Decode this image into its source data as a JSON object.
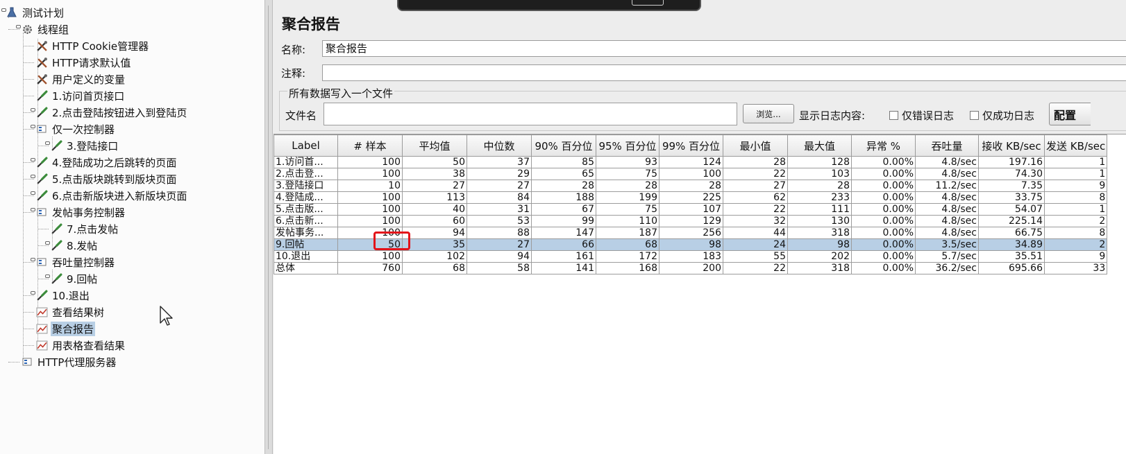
{
  "tree": {
    "items": [
      {
        "label": "测试计划",
        "icon": "test-plan-icon"
      },
      {
        "label": "线程组",
        "icon": "gear-icon"
      },
      {
        "label": "HTTP Cookie管理器",
        "icon": "config-element-icon"
      },
      {
        "label": "HTTP请求默认值",
        "icon": "config-element-icon"
      },
      {
        "label": "用户定义的变量",
        "icon": "config-element-icon"
      },
      {
        "label": "1.访问首页接口",
        "icon": "sampler-icon"
      },
      {
        "label": "2.点击登陆按钮进入到登陆页",
        "icon": "sampler-icon"
      },
      {
        "label": "仅一次控制器",
        "icon": "controller-icon"
      },
      {
        "label": "3.登陆接口",
        "icon": "sampler-icon"
      },
      {
        "label": "4.登陆成功之后跳转的页面",
        "icon": "sampler-icon"
      },
      {
        "label": "5.点击版块跳转到版块页面",
        "icon": "sampler-icon"
      },
      {
        "label": "6.点击新版块进入新版块页面",
        "icon": "sampler-icon"
      },
      {
        "label": "发帖事务控制器",
        "icon": "controller-icon"
      },
      {
        "label": "7.点击发帖",
        "icon": "sampler-icon"
      },
      {
        "label": "8.发帖",
        "icon": "sampler-icon"
      },
      {
        "label": "吞吐量控制器",
        "icon": "controller-icon"
      },
      {
        "label": "9.回帖",
        "icon": "sampler-icon"
      },
      {
        "label": "10.退出",
        "icon": "sampler-icon"
      },
      {
        "label": "查看结果树",
        "icon": "listener-icon"
      },
      {
        "label": "聚合报告",
        "icon": "listener-icon"
      },
      {
        "label": "用表格查看结果",
        "icon": "listener-icon"
      },
      {
        "label": "HTTP代理服务器",
        "icon": "proxy-icon"
      }
    ],
    "selected_index": 19
  },
  "panel": {
    "title": "聚合报告",
    "name_label": "名称:",
    "name_value": "聚合报告",
    "comment_label": "注释:",
    "comment_value": "",
    "file_group_title": "所有数据写入一个文件",
    "filename_label": "文件名",
    "filename_value": "",
    "browse_label": "浏览...",
    "log_content_label": "显示日志内容:",
    "errors_only_label": "仅错误日志",
    "success_only_label": "仅成功日志",
    "config_label": "配置"
  },
  "table": {
    "headers": [
      "Label",
      "# 样本",
      "平均值",
      "中位数",
      "90% 百分位",
      "95% 百分位",
      "99% 百分位",
      "最小值",
      "最大值",
      "异常 %",
      "吞吐量",
      "接收 KB/sec",
      "发送 KB/sec"
    ],
    "rows": [
      [
        "1.访问首...",
        "100",
        "50",
        "37",
        "85",
        "93",
        "124",
        "28",
        "128",
        "0.00%",
        "4.8/sec",
        "197.16",
        "1"
      ],
      [
        "2.点击登...",
        "100",
        "38",
        "29",
        "65",
        "75",
        "100",
        "22",
        "103",
        "0.00%",
        "4.8/sec",
        "74.30",
        "1"
      ],
      [
        "3.登陆接口",
        "10",
        "27",
        "27",
        "28",
        "28",
        "28",
        "27",
        "28",
        "0.00%",
        "11.2/sec",
        "7.35",
        "9"
      ],
      [
        "4.登陆成...",
        "100",
        "113",
        "84",
        "188",
        "199",
        "225",
        "62",
        "233",
        "0.00%",
        "4.8/sec",
        "33.75",
        "8"
      ],
      [
        "5.点击版...",
        "100",
        "40",
        "31",
        "67",
        "75",
        "107",
        "22",
        "111",
        "0.00%",
        "4.8/sec",
        "54.07",
        "1"
      ],
      [
        "6.点击新...",
        "100",
        "60",
        "53",
        "99",
        "110",
        "129",
        "32",
        "130",
        "0.00%",
        "4.8/sec",
        "225.14",
        "2"
      ],
      [
        "发帖事务...",
        "100",
        "94",
        "88",
        "147",
        "187",
        "256",
        "44",
        "318",
        "0.00%",
        "4.8/sec",
        "66.75",
        "8"
      ],
      [
        "9.回帖",
        "50",
        "35",
        "27",
        "66",
        "68",
        "98",
        "24",
        "98",
        "0.00%",
        "3.5/sec",
        "34.89",
        "2"
      ],
      [
        "10.退出",
        "100",
        "102",
        "94",
        "161",
        "172",
        "183",
        "55",
        "202",
        "0.00%",
        "5.7/sec",
        "35.51",
        "9"
      ],
      [
        "总体",
        "760",
        "68",
        "58",
        "141",
        "168",
        "200",
        "22",
        "318",
        "0.00%",
        "36.2/sec",
        "695.66",
        "33"
      ]
    ],
    "selected_row": 7
  }
}
